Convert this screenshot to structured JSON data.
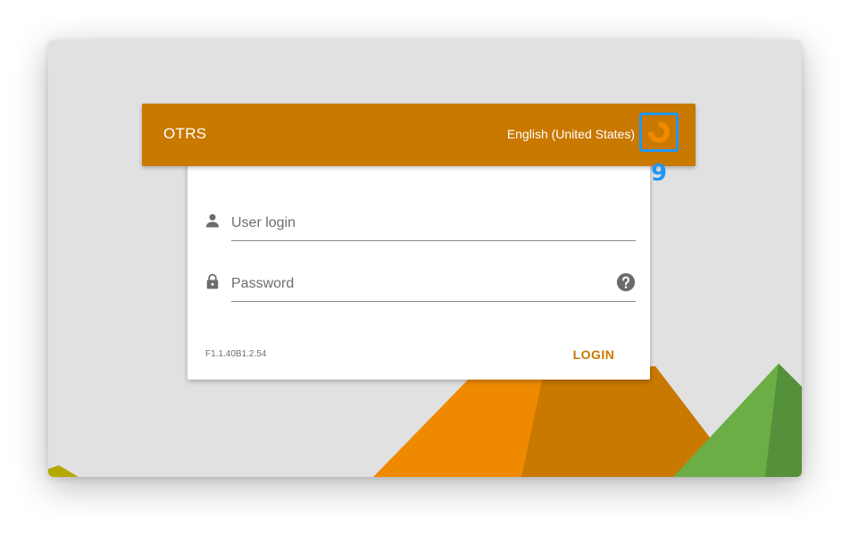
{
  "header": {
    "brand": "OTRS",
    "language": "English (United States)",
    "language_button_icon": "refresh-icon",
    "annotation_label": "9"
  },
  "form": {
    "user_login": {
      "placeholder": "User login",
      "value": "",
      "icon": "person-icon"
    },
    "password": {
      "placeholder": "Password",
      "value": "",
      "icon": "lock-icon",
      "help_icon": "help-icon"
    },
    "version": "F1.1.40B1.2.54",
    "login_label": "LOGIN"
  },
  "colors": {
    "brand_orange": "#c97800",
    "annotation_blue": "#2196f3",
    "background": "#e1e1e1"
  }
}
